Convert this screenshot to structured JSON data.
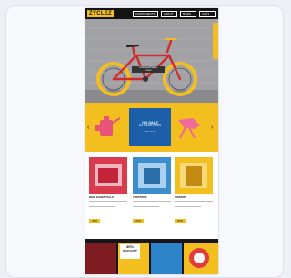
{
  "site": {
    "logo": "ZYCLEZ",
    "nav": [
      "COMPONENTS",
      "ABOUT",
      "BIKES",
      "CART"
    ]
  },
  "hero": {
    "caption": "SINGLESPEED",
    "subcaption": "STREET"
  },
  "promo": {
    "title": "ON SALE",
    "subtitle": "ALL COLOR CHAINS",
    "link": "SHOP NOW",
    "prev": "‹",
    "next": "›"
  },
  "cards": [
    {
      "title": "BIKE ESSENTIALS",
      "button": "VIEW"
    },
    {
      "title": "TWISTERS",
      "button": "VIEW"
    },
    {
      "title": "TOWERS",
      "button": "VIEW"
    }
  ],
  "footer": {
    "sale_pct": "30%",
    "sale_label": "DISCOUNT"
  },
  "colors": {
    "accent_yellow": "#f3bf1f",
    "promo_blue": "#1c5fa8",
    "dark": "#141414",
    "pink": "#e8537a"
  },
  "icons": [
    "bike-illustration",
    "pink-bike-part-icon",
    "prev-arrow-icon",
    "next-arrow-icon"
  ]
}
